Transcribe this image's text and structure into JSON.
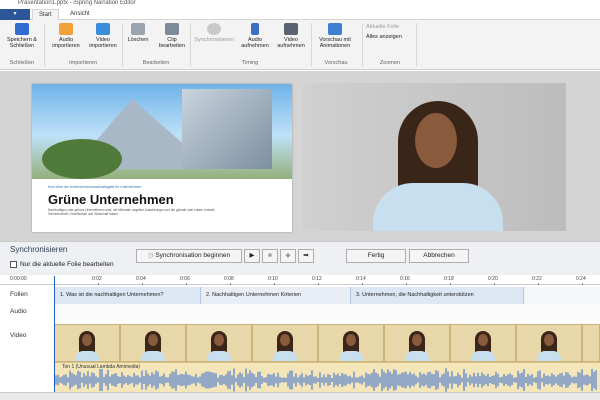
{
  "window": {
    "title": "Präsentation1.pptx - iSpring Narration Editor"
  },
  "menu": {
    "file": "",
    "tabs": [
      "Start",
      "Ansicht"
    ]
  },
  "ribbon": {
    "buttons": [
      {
        "label": "Speichern & Schließen",
        "icon": "save-icon"
      },
      {
        "label": "Audio importieren",
        "icon": "speaker-icon"
      },
      {
        "label": "Video importieren",
        "icon": "film-icon"
      },
      {
        "label": "Löschen",
        "icon": "trash-icon"
      },
      {
        "label": "Clip bearbeiten",
        "icon": "clip-icon"
      },
      {
        "label": "Synchronisieren",
        "icon": "stopwatch-icon"
      },
      {
        "label": "Audio aufnehmen",
        "icon": "microphone-icon"
      },
      {
        "label": "Video aufnehmen",
        "icon": "camera-icon"
      },
      {
        "label": "Vorschau mit Animationen",
        "icon": "preview-icon"
      }
    ],
    "zoom": {
      "current": "Aktuelle Folie",
      "all": "Alles anzeigen"
    },
    "groups": [
      "Schließen",
      "Importieren",
      "Bearbeiten",
      "Timing",
      "Vorschau",
      "Zoomen"
    ]
  },
  "slide": {
    "kicker": "Kurs über die Unternehmensnachhaltigkeit für Unternehmen",
    "title": "Grüne Unternehmen",
    "description": "Nachhaltiges oder grünes Unternehmen sind, die Minimale negative Auswirkungen auf die globale oder lokale Umwelt, Gemeinschaft, Gesellschaft und Wirtschaft haben."
  },
  "sync": {
    "title": "Synchronisieren",
    "checkbox": "Nur die aktuelle Folie bearbeiten",
    "begin": "Synchronisation beginnen",
    "play": "▶",
    "stop": "■",
    "back": "◆",
    "next": "➡",
    "done": "Fertig",
    "cancel": "Abbrechen"
  },
  "timeline": {
    "start": "0:00:00",
    "ticks": [
      "0:02",
      "0:04",
      "0:06",
      "0:08",
      "0:10",
      "0:12",
      "0:14",
      "0:16",
      "0:18",
      "0:20",
      "0:22",
      "0:24"
    ],
    "labels": {
      "slides": "Folien",
      "audio": "Audio",
      "video": "Video"
    },
    "segments": [
      "1. Was ist die nachhaltigen Unternehmen?",
      "2. Nachhaltigen Unternehmen Kriterien",
      "3. Unternehmen, die Nachhaltigkeit unterstützen"
    ],
    "audio_clip": "Ton 1 (Unusual Lambda Amimedia)"
  },
  "colors": {
    "accent": "#2b579a",
    "playhead": "#1e5fbf",
    "waveform": "#2f6bd1"
  }
}
